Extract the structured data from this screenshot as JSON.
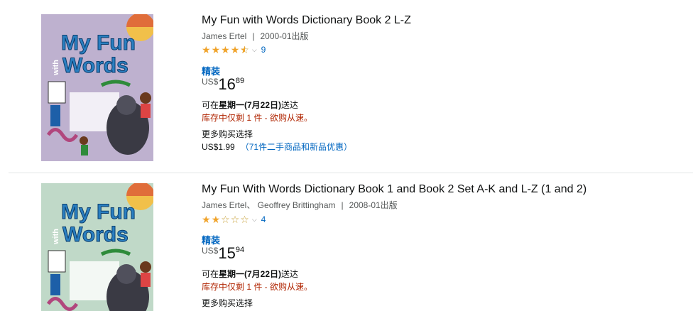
{
  "results": [
    {
      "title": "My Fun with Words Dictionary Book 2 L-Z",
      "authors": "James Ertel",
      "date": "2000-01出版",
      "rating_stars": 4.5,
      "review_count": "9",
      "format": "精装",
      "price": {
        "currency": "US$",
        "whole": "16",
        "fraction": "89"
      },
      "delivery_prefix": "可在",
      "delivery_date": "星期一(7月22日)",
      "delivery_suffix": "送达",
      "stock": "库存中仅剩 1 件 - 欲购从速。",
      "more_options": "更多购买选择",
      "used_price": "US$1.99",
      "used_link": "（71件二手商品和新品优惠）",
      "cover": {
        "line1": "My Fun",
        "line2": "Words",
        "with": "with"
      }
    },
    {
      "title": "My Fun With Words Dictionary Book 1 and Book 2 Set A-K and L-Z (1 and 2)",
      "authors": "James Ertel、 Geoffrey Brittingham",
      "date": "2008-01出版",
      "rating_stars": 2,
      "review_count": "4",
      "format": "精装",
      "price": {
        "currency": "US$",
        "whole": "15",
        "fraction": "94"
      },
      "delivery_prefix": "可在",
      "delivery_date": "星期一(7月22日)",
      "delivery_suffix": "送达",
      "stock": "库存中仅剩 1 件 - 欲购从速。",
      "more_options": "更多购买选择",
      "cover": {
        "line1": "My Fun",
        "line2": "Words",
        "with": "with"
      }
    }
  ],
  "colors": {
    "link": "#0066c0",
    "stock_red": "#b12704",
    "star": "#f0a32a",
    "cover1_bg": "#b8a9c9",
    "cover2_bg": "#a9d3c0",
    "cover_title": "#2a7fc1"
  }
}
